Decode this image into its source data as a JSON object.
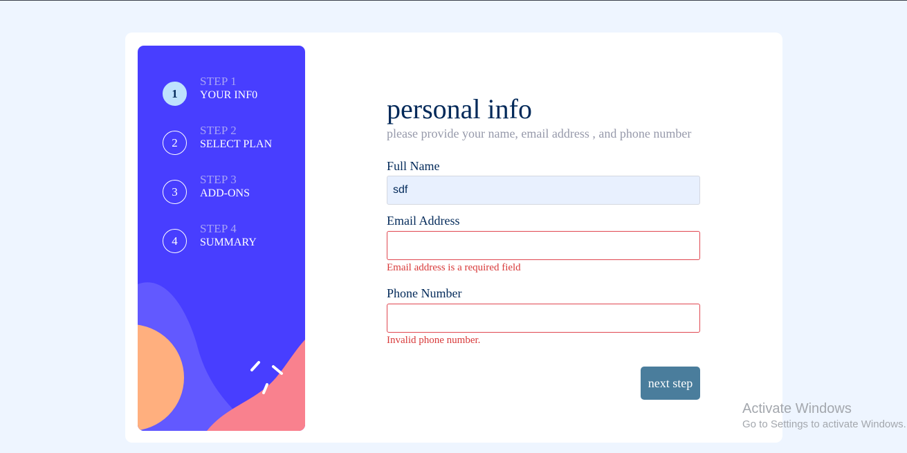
{
  "steps": [
    {
      "label": "STEP 1",
      "title": "YOUR INF0",
      "number": "1",
      "active": true
    },
    {
      "label": "STEP 2",
      "title": "SELECT PLAN",
      "number": "2",
      "active": false
    },
    {
      "label": "STEP 3",
      "title": "ADD-ONS",
      "number": "3",
      "active": false
    },
    {
      "label": "STEP 4",
      "title": "SUMMARY",
      "number": "4",
      "active": false
    }
  ],
  "form": {
    "title": "personal info",
    "subtitle": "please provide your name, email address , and phone number",
    "name_label": "Full Name",
    "name_value": "sdf",
    "email_label": "Email Address",
    "email_value": "",
    "email_error": "Email address is a required field",
    "phone_label": "Phone Number",
    "phone_value": "",
    "phone_error": "Invalid phone number.",
    "next_label": "next step"
  },
  "watermark": {
    "line1": "Activate Windows",
    "line2": "Go to Settings to activate Windows."
  },
  "colors": {
    "sidebar": "#483eff",
    "active_step": "#bee2fd",
    "primary_text": "#022959",
    "error": "#d83a3a",
    "button": "#4a7d9c"
  }
}
